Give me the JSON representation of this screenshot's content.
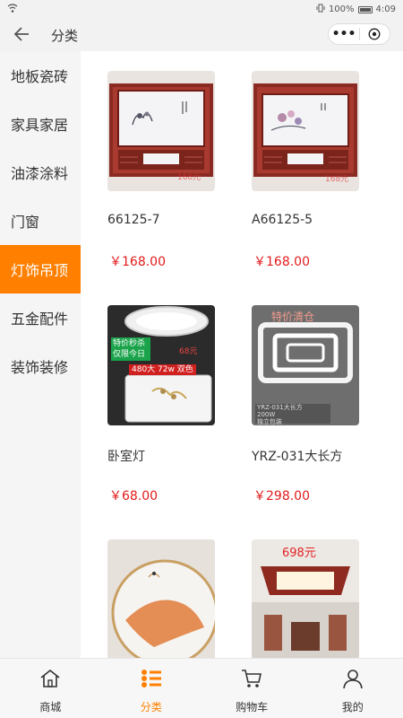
{
  "status_bar": {
    "battery": "100%",
    "time": "4:09"
  },
  "nav": {
    "title": "分类",
    "more_label": "•••"
  },
  "categories": [
    {
      "label": "地板瓷砖"
    },
    {
      "label": "家具家居"
    },
    {
      "label": "油漆涂料"
    },
    {
      "label": "门窗"
    },
    {
      "label": "灯饰吊顶"
    },
    {
      "label": "五金配件"
    },
    {
      "label": "装饰装修"
    }
  ],
  "active_category_index": 4,
  "products": [
    {
      "name": "66125-7",
      "price": "￥168.00",
      "image_label": "168元"
    },
    {
      "name": "A66125-5",
      "price": "￥168.00",
      "image_label": "168元"
    },
    {
      "name": "卧室灯",
      "price": "￥68.00",
      "image_text": [
        "特价秒杀",
        "仅限今日",
        "68元",
        "480大 72w 双色"
      ]
    },
    {
      "name": "YRZ-031大长方",
      "price": "￥298.00",
      "image_text": [
        "特价清仓",
        "YRZ-031大长方",
        "200W",
        "独立包装"
      ]
    },
    {
      "name": "",
      "price": ""
    },
    {
      "name": "",
      "price": "",
      "image_label": "698元"
    }
  ],
  "tabbar": [
    {
      "label": "商城",
      "icon": "home-icon"
    },
    {
      "label": "分类",
      "icon": "category-list-icon"
    },
    {
      "label": "购物车",
      "icon": "cart-icon"
    },
    {
      "label": "我的",
      "icon": "user-icon"
    }
  ],
  "colors": {
    "accent": "#ff7f00",
    "price": "#e31b1b"
  }
}
